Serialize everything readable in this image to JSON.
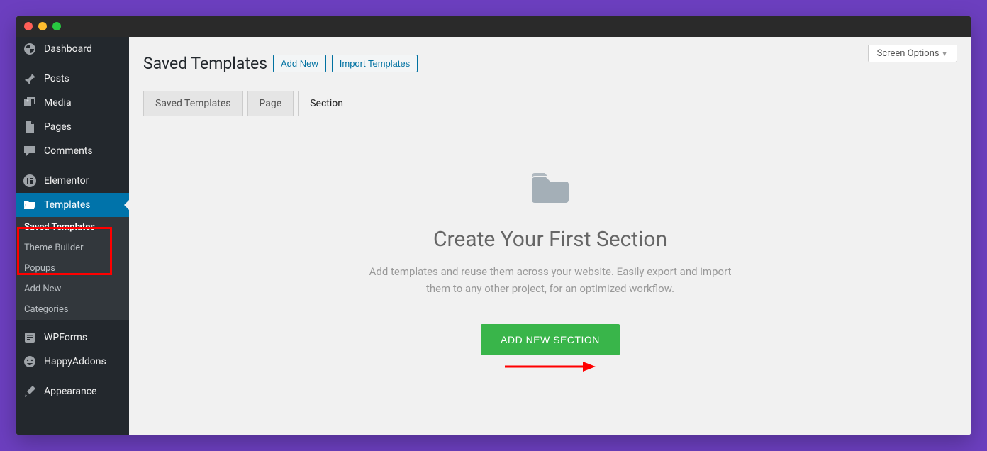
{
  "sidebar": {
    "items": [
      {
        "label": "Dashboard"
      },
      {
        "label": "Posts"
      },
      {
        "label": "Media"
      },
      {
        "label": "Pages"
      },
      {
        "label": "Comments"
      },
      {
        "label": "Elementor"
      },
      {
        "label": "Templates"
      },
      {
        "label": "WPForms"
      },
      {
        "label": "HappyAddons"
      },
      {
        "label": "Appearance"
      }
    ],
    "submenu": [
      {
        "label": "Saved Templates"
      },
      {
        "label": "Theme Builder"
      },
      {
        "label": "Popups"
      },
      {
        "label": "Add New"
      },
      {
        "label": "Categories"
      }
    ]
  },
  "header": {
    "title": "Saved Templates",
    "add_new": "Add New",
    "import": "Import Templates",
    "screen_options": "Screen Options"
  },
  "tabs": [
    {
      "label": "Saved Templates"
    },
    {
      "label": "Page"
    },
    {
      "label": "Section"
    }
  ],
  "empty": {
    "title": "Create Your First Section",
    "desc": "Add templates and reuse them across your website. Easily export and import them to any other project, for an optimized workflow.",
    "button": "ADD NEW SECTION"
  }
}
